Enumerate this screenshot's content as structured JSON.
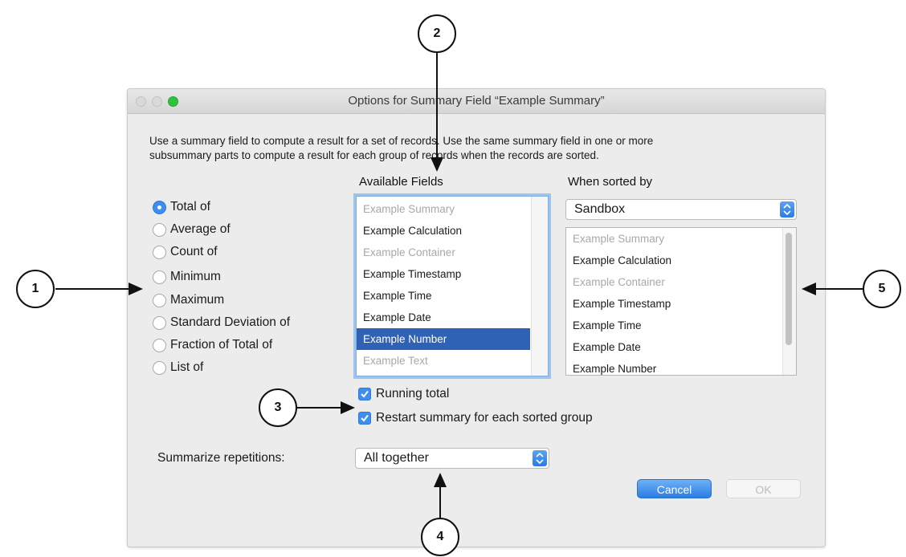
{
  "dialog": {
    "title": "Options for Summary Field “Example Summary”",
    "description_line1": "Use a summary field to compute a result for a set of records. Use the same summary field in one or more",
    "description_line2": "subsummary parts to compute a result for each group of records when the records are sorted."
  },
  "summary_types": [
    {
      "label": "Total of",
      "selected": true
    },
    {
      "label": "Average of",
      "selected": false
    },
    {
      "label": "Count of",
      "selected": false
    },
    {
      "label": "Minimum",
      "selected": false
    },
    {
      "label": "Maximum",
      "selected": false
    },
    {
      "label": "Standard Deviation of",
      "selected": false
    },
    {
      "label": "Fraction of Total of",
      "selected": false
    },
    {
      "label": "List of",
      "selected": false
    }
  ],
  "available_fields": {
    "heading": "Available Fields",
    "items": [
      {
        "label": "Example Summary",
        "state": "dim"
      },
      {
        "label": "Example Calculation",
        "state": "normal"
      },
      {
        "label": "Example Container",
        "state": "dim"
      },
      {
        "label": "Example Timestamp",
        "state": "normal"
      },
      {
        "label": "Example Time",
        "state": "normal"
      },
      {
        "label": "Example Date",
        "state": "normal"
      },
      {
        "label": "Example Number",
        "state": "selected"
      },
      {
        "label": "Example Text",
        "state": "dim"
      }
    ]
  },
  "sorted_by": {
    "heading": "When sorted by",
    "table_value": "Sandbox",
    "items": [
      {
        "label": "Example Summary",
        "state": "dim"
      },
      {
        "label": "Example Calculation",
        "state": "normal"
      },
      {
        "label": "Example Container",
        "state": "dim"
      },
      {
        "label": "Example Timestamp",
        "state": "normal"
      },
      {
        "label": "Example Time",
        "state": "normal"
      },
      {
        "label": "Example Date",
        "state": "normal"
      },
      {
        "label": "Example Number",
        "state": "normal"
      }
    ]
  },
  "options": {
    "running_total": "Running total",
    "restart_summary": "Restart summary for each sorted group"
  },
  "repetitions": {
    "label": "Summarize repetitions:",
    "value": "All together"
  },
  "buttons": {
    "cancel": "Cancel",
    "ok": "OK"
  },
  "callouts": [
    "1",
    "2",
    "3",
    "4",
    "5"
  ],
  "colors": {
    "accent": "#3d8ef0",
    "selection": "#2f62b4",
    "dialog_bg": "#ececec",
    "window_green": "#2fc23e"
  }
}
